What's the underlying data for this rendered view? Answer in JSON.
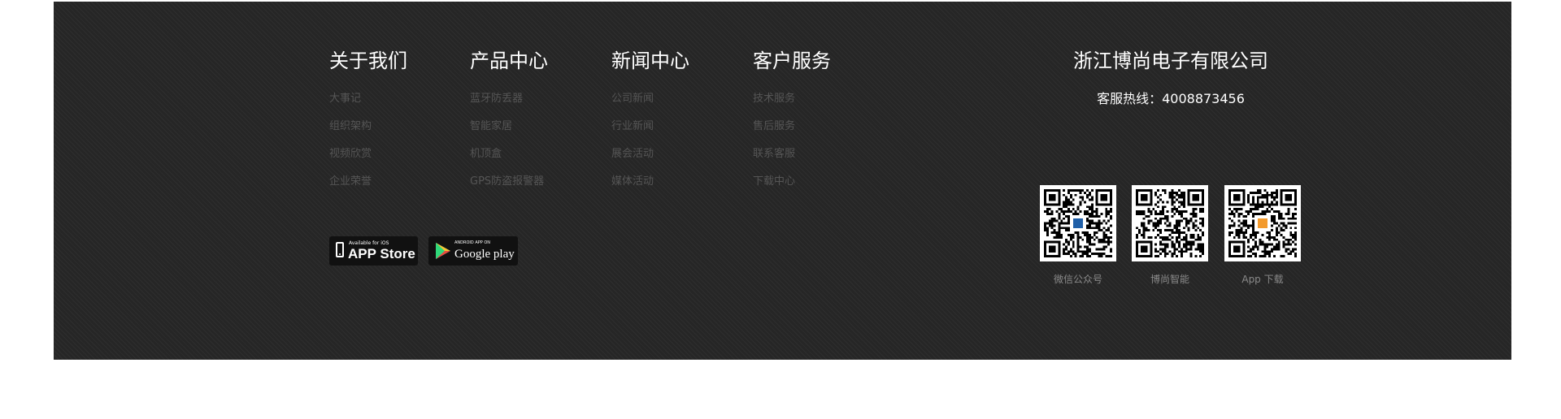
{
  "columns": [
    {
      "title": "关于我们",
      "links": [
        "大事记",
        "组织架构",
        "视频欣赏",
        "企业荣誉"
      ]
    },
    {
      "title": "产品中心",
      "links": [
        "蓝牙防丢器",
        "智能家居",
        "机顶盒",
        "GPS防盗报警器"
      ]
    },
    {
      "title": "新闻中心",
      "links": [
        "公司新闻",
        "行业新闻",
        "展会活动",
        "媒体活动"
      ]
    },
    {
      "title": "客户服务",
      "links": [
        "技术服务",
        "售后服务",
        "联系客服",
        "下载中心"
      ]
    }
  ],
  "badges": {
    "ios": {
      "small": "Available for iOS",
      "big": "APP Store",
      "icon": "phone-icon"
    },
    "google": {
      "small": "ANDROID APP ON",
      "big": "Google play",
      "icon": "play-icon"
    }
  },
  "company": {
    "name": "浙江博尚电子有限公司",
    "hotline": "客服热线：4008873456"
  },
  "qr_codes": [
    {
      "caption": "微信公众号",
      "center_color": "#1f5fa8"
    },
    {
      "caption": "博尚智能",
      "center_color": ""
    },
    {
      "caption": "App 下载",
      "center_color": "#f39a2c"
    }
  ],
  "colors": {
    "footer_bg": "#262626",
    "title": "#ffffff",
    "link": "#555555",
    "caption": "#8a8a8a"
  }
}
